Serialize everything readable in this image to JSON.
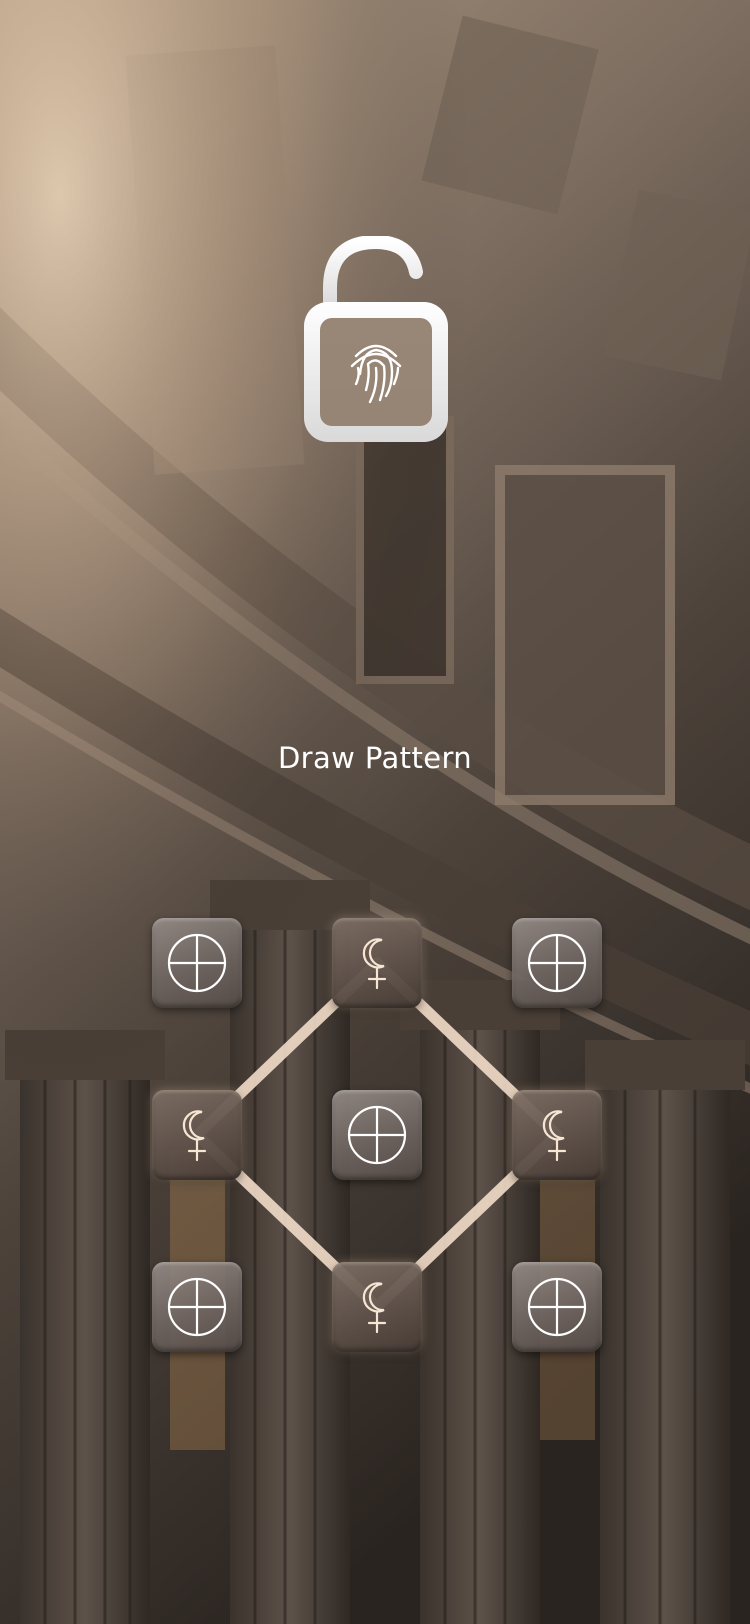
{
  "screen": {
    "title": "Draw Pattern"
  },
  "lock": {
    "icon": "unlocked-padlock-fingerprint-icon",
    "state": "unlocked"
  },
  "pattern": {
    "grid": [
      3,
      3
    ],
    "idle_icon": "crosshair-circle-icon",
    "active_icon": "moon-venus-symbol-icon",
    "selected_sequence": [
      1,
      5,
      7,
      3,
      1
    ],
    "nodes": [
      {
        "row": 0,
        "col": 0,
        "selected": false
      },
      {
        "row": 0,
        "col": 1,
        "selected": true
      },
      {
        "row": 0,
        "col": 2,
        "selected": false
      },
      {
        "row": 1,
        "col": 0,
        "selected": true
      },
      {
        "row": 1,
        "col": 1,
        "selected": false
      },
      {
        "row": 1,
        "col": 2,
        "selected": true
      },
      {
        "row": 2,
        "col": 0,
        "selected": false
      },
      {
        "row": 2,
        "col": 1,
        "selected": true
      },
      {
        "row": 2,
        "col": 2,
        "selected": false
      }
    ]
  },
  "colors": {
    "line": "#f1dcc8",
    "icon_stroke": "#ffffff",
    "active_icon_stroke": "#f6e6d3",
    "text": "#ffffff"
  }
}
